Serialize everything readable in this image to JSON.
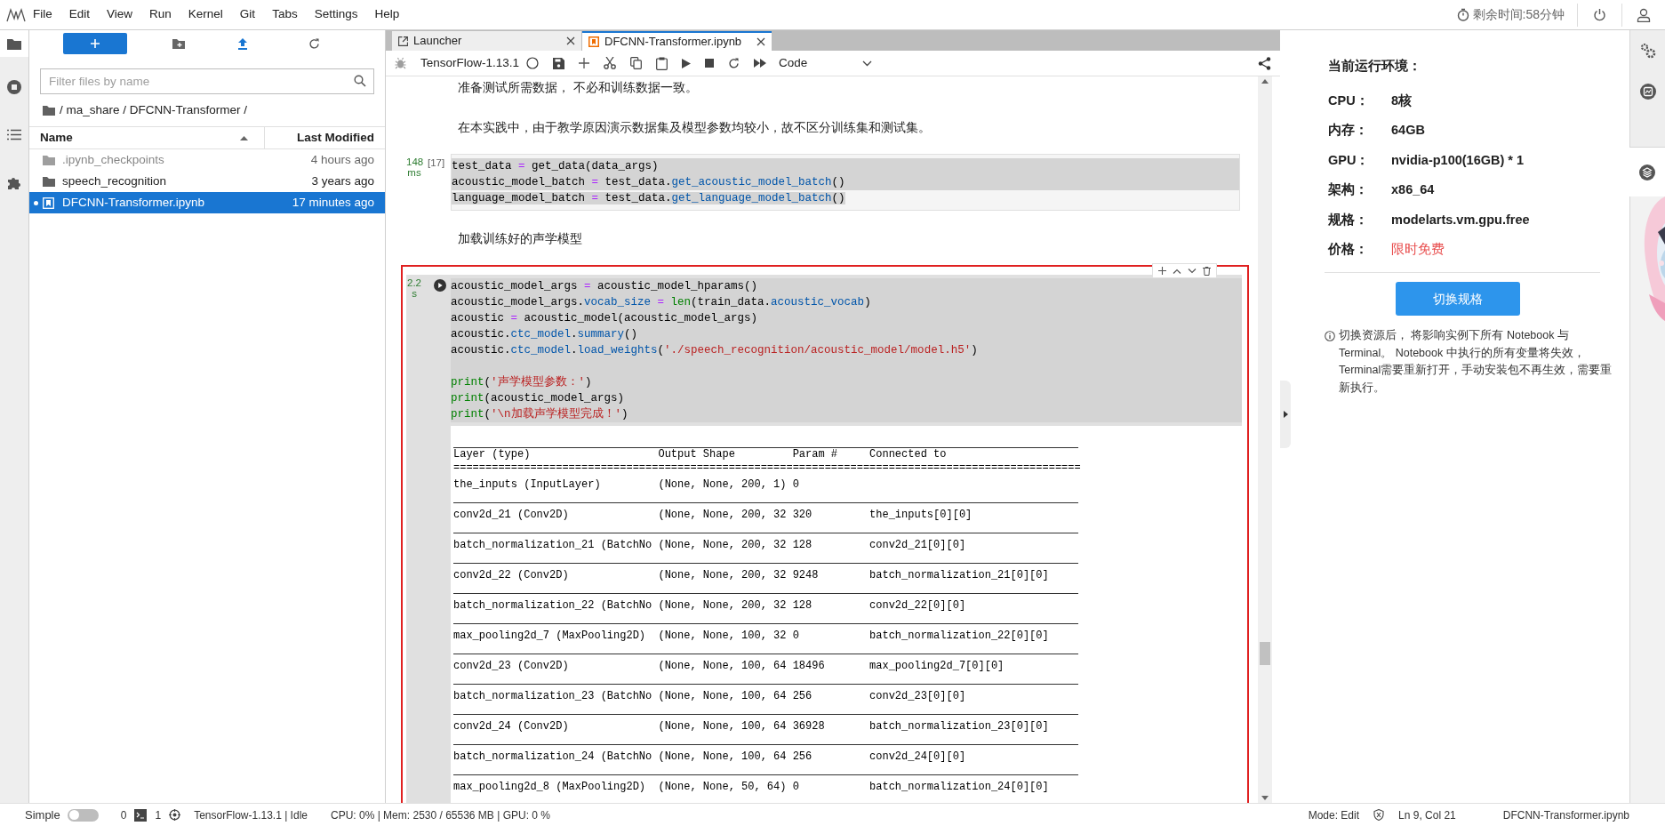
{
  "menu": [
    "File",
    "Edit",
    "View",
    "Run",
    "Kernel",
    "Git",
    "Tabs",
    "Settings",
    "Help"
  ],
  "top_bar": {
    "timer": "剩余时间:58分钟"
  },
  "file_browser": {
    "filter_placeholder": "Filter files by name",
    "path": "/ ma_share / DFCNN-Transformer /",
    "columns": [
      "Name",
      "Last Modified"
    ],
    "files": [
      {
        "kind": "folder",
        "name": ".ipynb_checkpoints",
        "modified": "4 hours ago",
        "hidden": true,
        "selected": false,
        "running": false
      },
      {
        "kind": "folder",
        "name": "speech_recognition",
        "modified": "3 years ago",
        "hidden": false,
        "selected": false,
        "running": false
      },
      {
        "kind": "notebook",
        "name": "DFCNN-Transformer.ipynb",
        "modified": "17 minutes ago",
        "hidden": false,
        "selected": true,
        "running": true
      }
    ]
  },
  "tabs": [
    {
      "kind": "launcher",
      "label": "Launcher",
      "selected": false
    },
    {
      "kind": "notebook",
      "label": "DFCNN-Transformer.ipynb",
      "selected": true
    }
  ],
  "toolbar": {
    "kernel": "TensorFlow-1.13.1",
    "cell_type": "Code"
  },
  "cells": [
    {
      "kind": "markdown",
      "paragraphs": [
        "准备测试所需数据， 不必和训练数据一致。",
        "在本实践中，由于教学原因演示数据集及模型参数均较小，故不区分训练集和测试集。"
      ]
    },
    {
      "kind": "code",
      "time": "148 ms",
      "prompt": "[17]",
      "active": false,
      "outlined": false,
      "lines": [
        {
          "kind": "code",
          "selected": true,
          "tokens": [
            {
              "kind": "plain",
              "text": "test_data"
            },
            {
              "kind": "op",
              "text": " = "
            },
            {
              "kind": "plain",
              "text": "get_data(data_args)"
            }
          ]
        },
        {
          "kind": "code",
          "selected": true,
          "tokens": [
            {
              "kind": "plain",
              "text": "acoustic_model_batch"
            },
            {
              "kind": "op",
              "text": " = "
            },
            {
              "kind": "plain",
              "text": "test_data."
            },
            {
              "kind": "prop",
              "text": "get_acoustic_model_batch"
            },
            {
              "kind": "plain",
              "text": "()"
            }
          ]
        },
        {
          "kind": "code",
          "selected": false,
          "tokens": [
            {
              "kind": "plain",
              "text": "language_model_batch"
            },
            {
              "kind": "op",
              "text": " = "
            },
            {
              "kind": "plain",
              "text": "test_data."
            },
            {
              "kind": "prop",
              "text": "get_language_model_batch"
            },
            {
              "kind": "plain",
              "text": "()"
            }
          ]
        }
      ]
    },
    {
      "kind": "markdown",
      "paragraphs": [
        "加载训练好的声学模型"
      ]
    },
    {
      "kind": "code",
      "time": "2.2 s",
      "active": true,
      "outlined": true,
      "lines": [
        {
          "kind": "code",
          "selected": true,
          "tokens": [
            {
              "kind": "plain",
              "text": "acoustic_model_args"
            },
            {
              "kind": "op",
              "text": " = "
            },
            {
              "kind": "plain",
              "text": "acoustic_model_hparams()"
            }
          ]
        },
        {
          "kind": "code",
          "selected": true,
          "tokens": [
            {
              "kind": "plain",
              "text": "acoustic_model_args."
            },
            {
              "kind": "prop",
              "text": "vocab_size"
            },
            {
              "kind": "op",
              "text": " = "
            },
            {
              "kind": "builtin",
              "text": "len"
            },
            {
              "kind": "plain",
              "text": "(train_data."
            },
            {
              "kind": "prop",
              "text": "acoustic_vocab"
            },
            {
              "kind": "plain",
              "text": ")"
            }
          ]
        },
        {
          "kind": "code",
          "selected": true,
          "tokens": [
            {
              "kind": "plain",
              "text": "acoustic"
            },
            {
              "kind": "op",
              "text": " = "
            },
            {
              "kind": "plain",
              "text": "acoustic_model(acoustic_model_args)"
            }
          ]
        },
        {
          "kind": "code",
          "selected": true,
          "tokens": [
            {
              "kind": "plain",
              "text": "acoustic."
            },
            {
              "kind": "prop",
              "text": "ctc_model"
            },
            {
              "kind": "plain",
              "text": "."
            },
            {
              "kind": "prop",
              "text": "summary"
            },
            {
              "kind": "plain",
              "text": "()"
            }
          ]
        },
        {
          "kind": "code",
          "selected": true,
          "tokens": [
            {
              "kind": "plain",
              "text": "acoustic."
            },
            {
              "kind": "prop",
              "text": "ctc_model"
            },
            {
              "kind": "plain",
              "text": "."
            },
            {
              "kind": "prop",
              "text": "load_weights"
            },
            {
              "kind": "plain",
              "text": "("
            },
            {
              "kind": "string",
              "text": "'./speech_recognition/acoustic_model/model.h5'"
            },
            {
              "kind": "plain",
              "text": ")"
            }
          ]
        },
        {
          "kind": "blank",
          "selected": true
        },
        {
          "kind": "code",
          "selected": true,
          "tokens": [
            {
              "kind": "builtin",
              "text": "print"
            },
            {
              "kind": "plain",
              "text": "("
            },
            {
              "kind": "string",
              "text": "'声学模型参数：'"
            },
            {
              "kind": "plain",
              "text": ")"
            }
          ]
        },
        {
          "kind": "code",
          "selected": true,
          "tokens": [
            {
              "kind": "builtin",
              "text": "print"
            },
            {
              "kind": "plain",
              "text": "(acoustic_model_args)"
            }
          ]
        },
        {
          "kind": "code",
          "selected": true,
          "tokens": [
            {
              "kind": "builtin",
              "text": "print"
            },
            {
              "kind": "plain",
              "text": "("
            },
            {
              "kind": "string",
              "text": "'\\n加载声学模型完成！'"
            },
            {
              "kind": "plain",
              "text": ")"
            }
          ]
        }
      ],
      "output": {
        "columns": [
          "Layer (type)",
          "Output Shape",
          "Param #",
          "Connected to"
        ],
        "separator": "==================================================================================================",
        "rows": [
          [
            "the_inputs (InputLayer)",
            "(None, None, 200, 1)",
            "0",
            ""
          ],
          [
            "conv2d_21 (Conv2D)",
            "(None, None, 200, 32",
            "320",
            "the_inputs[0][0]"
          ],
          [
            "batch_normalization_21 (BatchNo",
            "(None, None, 200, 32",
            "128",
            "conv2d_21[0][0]"
          ],
          [
            "conv2d_22 (Conv2D)",
            "(None, None, 200, 32",
            "9248",
            "batch_normalization_21[0][0]"
          ],
          [
            "batch_normalization_22 (BatchNo",
            "(None, None, 200, 32",
            "128",
            "conv2d_22[0][0]"
          ],
          [
            "max_pooling2d_7 (MaxPooling2D)",
            "(None, None, 100, 32",
            "0",
            "batch_normalization_22[0][0]"
          ],
          [
            "conv2d_23 (Conv2D)",
            "(None, None, 100, 64",
            "18496",
            "max_pooling2d_7[0][0]"
          ],
          [
            "batch_normalization_23 (BatchNo",
            "(None, None, 100, 64",
            "256",
            "conv2d_23[0][0]"
          ],
          [
            "conv2d_24 (Conv2D)",
            "(None, None, 100, 64",
            "36928",
            "batch_normalization_23[0][0]"
          ],
          [
            "batch_normalization_24 (BatchNo",
            "(None, None, 100, 64",
            "256",
            "conv2d_24[0][0]"
          ],
          [
            "max_pooling2d_8 (MaxPooling2D)",
            "(None, None, 50, 64)",
            "0",
            "batch_normalization_24[0][0]"
          ]
        ]
      }
    }
  ],
  "right_panel": {
    "title": "当前运行环境：",
    "specs": [
      {
        "label": "CPU：",
        "value": "8核",
        "emphasis": false
      },
      {
        "label": "内存：",
        "value": "64GB",
        "emphasis": false
      },
      {
        "label": "GPU：",
        "value": "nvidia-p100(16GB) * 1",
        "emphasis": false
      },
      {
        "label": "架构：",
        "value": "x86_64",
        "emphasis": false
      },
      {
        "label": "规格：",
        "value": "modelarts.vm.gpu.free",
        "emphasis": false
      },
      {
        "label": "价格：",
        "value": "限时免费",
        "emphasis": true
      }
    ],
    "button": "切换规格",
    "note": "切换资源后， 将影响实例下所有 Notebook 与 Terminal。 Notebook 中执行的所有变量将失效，Terminal需要重新打开，手动安装包不再生效，需要重新执行。"
  },
  "status_bar": {
    "mode_toggle": {
      "label": "Simple",
      "on": false
    },
    "terminals": "0",
    "kernels": "1",
    "kernel_status": "TensorFlow-1.13.1 | Idle",
    "resources": "CPU: 0% | Mem: 2530 / 65536 MB | GPU: 0 %",
    "mode": "Mode: Edit",
    "position": "Ln 9, Col 21",
    "file": "DFCNN-Transformer.ipynb"
  }
}
